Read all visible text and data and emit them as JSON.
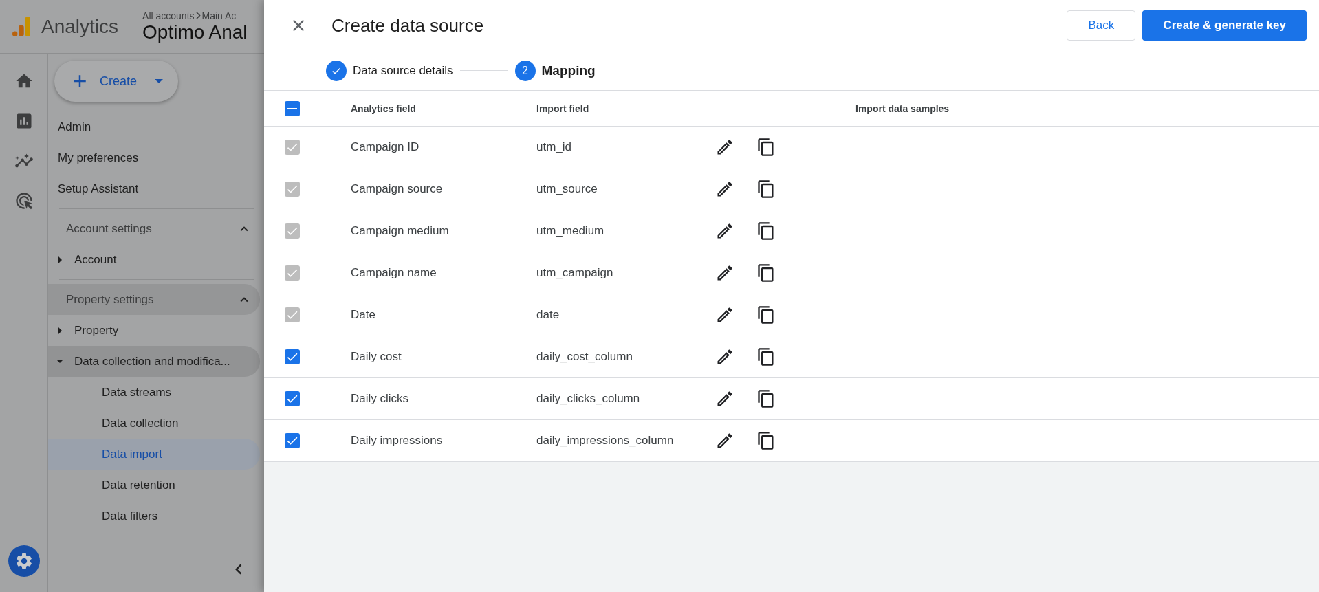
{
  "app_bar": {
    "product": "Analytics",
    "breadcrumb": [
      "All accounts",
      "Main Ac"
    ],
    "property": "Optimo Anal"
  },
  "nav": {
    "create_button": "Create",
    "items": [
      {
        "label": "Admin"
      },
      {
        "label": "My preferences"
      },
      {
        "label": "Setup Assistant"
      }
    ],
    "sections": [
      {
        "title": "Account settings",
        "expanded": true,
        "highlighted": false,
        "items": [
          {
            "label": "Account",
            "expanded": false,
            "highlighted": false
          }
        ]
      },
      {
        "title": "Property settings",
        "expanded": true,
        "highlighted": true,
        "items": [
          {
            "label": "Property",
            "expanded": false,
            "highlighted": false
          },
          {
            "label": "Data collection and modifica...",
            "expanded": true,
            "highlighted": true,
            "children": [
              {
                "label": "Data streams",
                "selected": false
              },
              {
                "label": "Data collection",
                "selected": false
              },
              {
                "label": "Data import",
                "selected": true
              },
              {
                "label": "Data retention",
                "selected": false
              },
              {
                "label": "Data filters",
                "selected": false
              }
            ]
          }
        ]
      }
    ]
  },
  "dialog": {
    "title": "Create data source",
    "back_button": "Back",
    "primary_button": "Create & generate key",
    "steps": [
      {
        "label": "Data source details",
        "done": true,
        "current": false
      },
      {
        "label": "Mapping",
        "done": false,
        "current": true,
        "number": "2"
      }
    ],
    "table": {
      "select_all": {
        "checked": true,
        "indeterminate": true
      },
      "columns": [
        "Analytics field",
        "Import field",
        "Import data samples"
      ],
      "rows": [
        {
          "analytics_field": "Campaign ID",
          "import_field": "utm_id",
          "checked": true,
          "disabled": true
        },
        {
          "analytics_field": "Campaign source",
          "import_field": "utm_source",
          "checked": true,
          "disabled": true
        },
        {
          "analytics_field": "Campaign medium",
          "import_field": "utm_medium",
          "checked": true,
          "disabled": true
        },
        {
          "analytics_field": "Campaign name",
          "import_field": "utm_campaign",
          "checked": true,
          "disabled": true
        },
        {
          "analytics_field": "Date",
          "import_field": "date",
          "checked": true,
          "disabled": true
        },
        {
          "analytics_field": "Daily cost",
          "import_field": "daily_cost_column",
          "checked": true,
          "disabled": false
        },
        {
          "analytics_field": "Daily clicks",
          "import_field": "daily_clicks_column",
          "checked": true,
          "disabled": false
        },
        {
          "analytics_field": "Daily impressions",
          "import_field": "daily_impressions_column",
          "checked": true,
          "disabled": false
        }
      ]
    }
  }
}
